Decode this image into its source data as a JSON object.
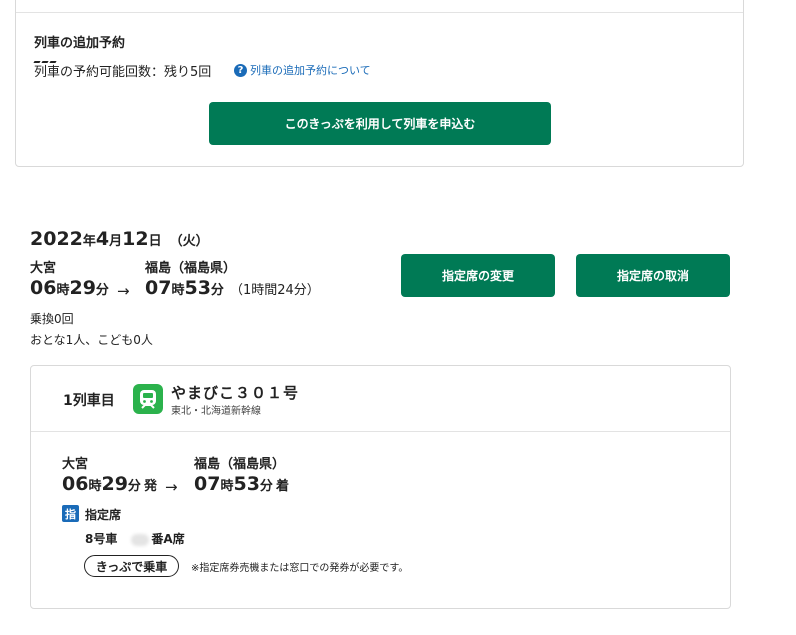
{
  "additional": {
    "title": "列車の追加予約",
    "remaining_text": "列車の予約可能回数：残り5回",
    "help_link": "列車の追加予約について",
    "help_icon": "?",
    "apply_button": "このきっぷを利用して列車を申込む"
  },
  "trip": {
    "year": "2022",
    "year_unit": "年",
    "month": "4",
    "month_unit": "月",
    "day": "12",
    "day_unit": "日",
    "weekday": "（火）",
    "from_station": "大宮",
    "to_station": "福島（福島県）",
    "dep_hour": "06",
    "dep_min": "29",
    "arr_hour": "07",
    "arr_min": "53",
    "hour_unit": "時",
    "min_unit": "分",
    "arrow": "→",
    "duration": "（1時間24分）",
    "transfers": "乗換0回",
    "passengers": "おとな1人、こども0人",
    "change_button": "指定席の変更",
    "cancel_button": "指定席の取消"
  },
  "train": {
    "car_no": "1列車目",
    "name": "やまびこ３０１号",
    "line": "東北・北海道新幹線",
    "from_station": "大宮",
    "to_station": "福島（福島県）",
    "dep_suffix": "発",
    "arr_suffix": "着",
    "seat_icon": "指",
    "seat_type": "指定席",
    "car": "8号車",
    "seat_suffix": "番A席",
    "ticket_label": "きっぷで乗車",
    "note": "※指定席券売機または窓口での発券が必要です。"
  },
  "colors": {
    "accent_green": "#007a55",
    "link_blue": "#1a6bb8",
    "train_icon_green": "#2bb24c"
  }
}
